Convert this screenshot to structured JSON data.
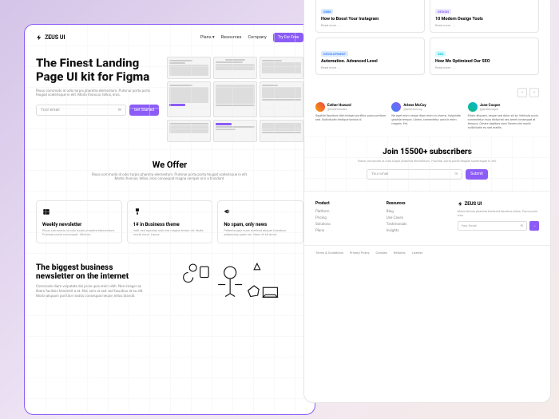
{
  "brand": "ZEUS UI",
  "nav": {
    "plans": "Plans",
    "resources": "Resources",
    "company": "Company",
    "cta": "Try For Free"
  },
  "hero": {
    "title": "The Finest Landing Page UI kit for Figma",
    "desc": "Risus commodo id odio turpis pharetra elementum. Pulvinar porta porta feugiat scelerisque in elit. Morbi rhoncus, tellus, eros.",
    "email": "Your email",
    "cta": "Get Started"
  },
  "mockup_header": "We Offer",
  "offer": {
    "title": "We Offer",
    "desc": "Risus commodo id odio turpis pharetra elementum. Pulvinar porta porta feugiat scelerisque in elit. Morbi rhoncus, tellus, eros consequat magna semper orci a tincidunt.",
    "items": [
      {
        "title": "Weekly newsletter",
        "desc": "Risus commodo id odio turpis pharetra elementum. Pulvinar porta consequat. Ultrices."
      },
      {
        "title": "1# in Business theme",
        "desc": "Velit sed egestas odio est magna lectus vel. Nulla morbi risus. Lacus."
      },
      {
        "title": "No spam, only news",
        "desc": "Pellentesque nunc eleifend aliquet interdum adipiscing quam ac. Nunc et sit amet."
      }
    ]
  },
  "biz": {
    "title": "The biggest business newsletter on the internet",
    "desc": "Commodo diam vulputate dui proin quis enim nibh. Non integer ac libero facilisis hendrerit a at. Nisi sem ut sed sed faucibus at eu elit. Morbi aliquam porttitor mattis consequat neque, tellus blandit."
  },
  "articles": [
    {
      "tag": "SMM",
      "tagClass": "tag-blue",
      "title": "How to Boost Your Instagram",
      "more": "Read more →"
    },
    {
      "tag": "DESIGN",
      "tagClass": "tag-purple",
      "title": "10 Modern Design Tools",
      "more": "Read more →"
    },
    {
      "tag": "DEVELOPMENT",
      "tagClass": "tag-blue",
      "title": "Automation. Advanced Level",
      "more": "Read more →"
    },
    {
      "tag": "SEO",
      "tagClass": "tag-cyan",
      "title": "How We Optimized Our SEO",
      "more": "Read more →"
    }
  ],
  "testimonials": [
    {
      "name": "Esther Howard",
      "handle": "@estherhoward",
      "text": "Sagittis faucibus nibh integer porttitor purus pretium sed. Sollicitudin tristique lacinia id."
    },
    {
      "name": "Arlene McCoy",
      "handle": "@arlenemccoy",
      "text": "Ne eget enim neque diam enim in viverra. Vulputate gravida tempor. Libero, consectetur urna in enim magnis. Est."
    },
    {
      "name": "Jane Cooper",
      "handle": "@janethcooper",
      "text": "Etiam aliquam, neque sed dolor sit at. Vehicula proin consectetur risus dictumst nec amet consequat at tempus. Ornare dapibus nunc fames nisi morbi sollicitudin eu sed mattis."
    }
  ],
  "subscribe": {
    "title": "Join 15500+ subscribers",
    "desc": "Risus commodo id odio turpis pharetra elementum. Pulvinar porta porta feugiat scelerisque in elit.",
    "email": "Your email",
    "cta": "Submit"
  },
  "footer": {
    "product": {
      "h": "Product",
      "links": [
        "Platform",
        "Pricing",
        "Solutions",
        "Plans"
      ]
    },
    "resources": {
      "h": "Resources",
      "links": [
        "Blog",
        "Use Cases",
        "Testimonials",
        "Insights"
      ]
    },
    "desc": "Morbi dictum pharetra hendrerit faucibus tellus. Purus proin cras.",
    "email": "Your Email"
  },
  "legal": [
    "Terms & Conditions",
    "Privacy Policy",
    "Cookies",
    "Refunds",
    "License"
  ]
}
